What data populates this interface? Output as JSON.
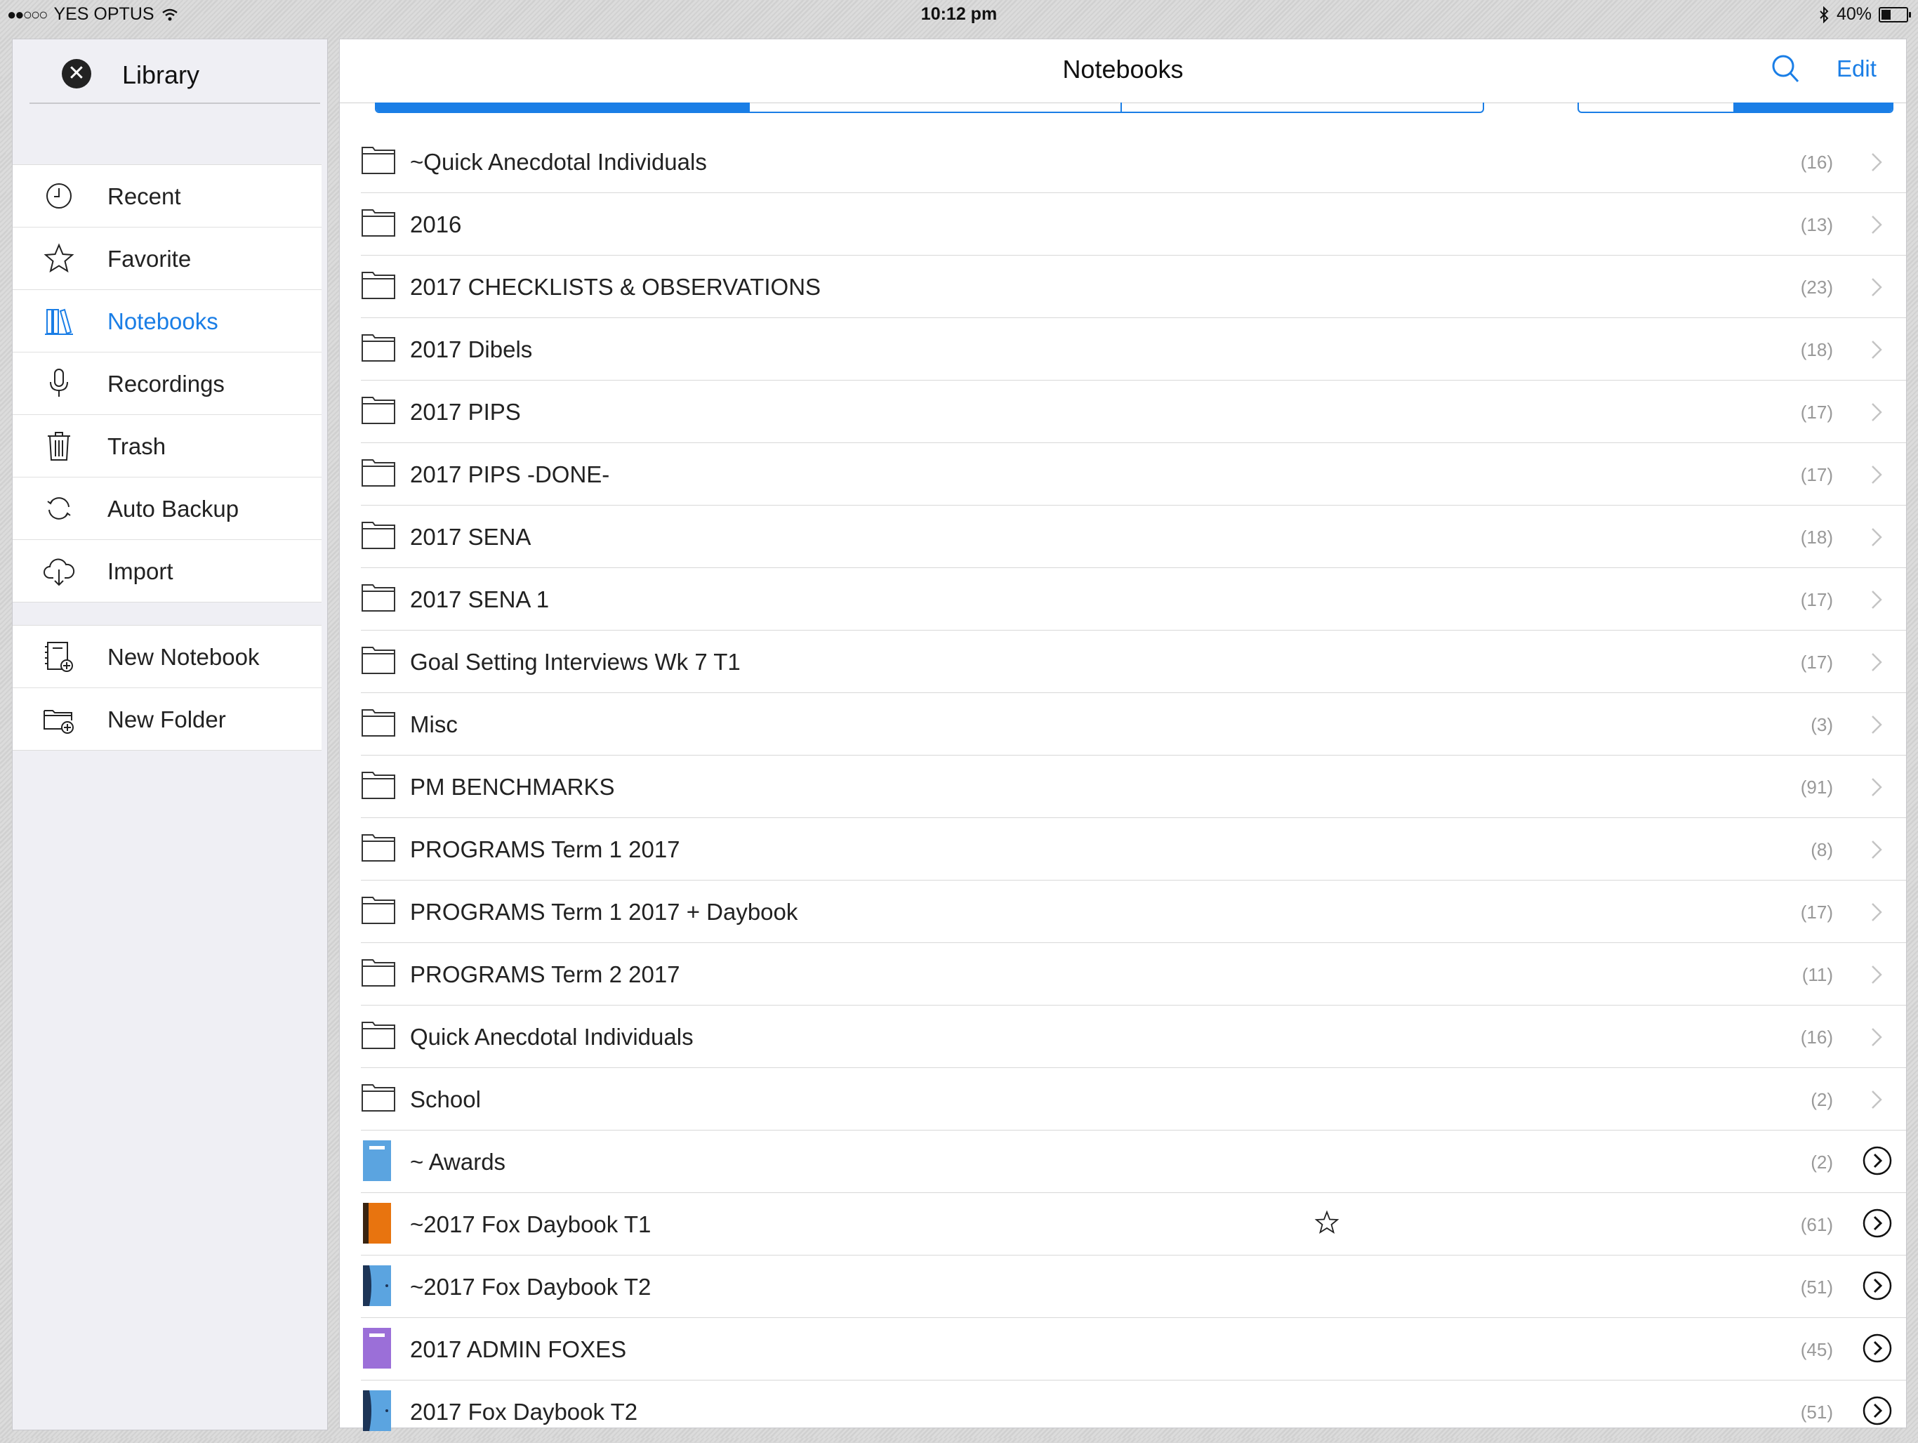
{
  "status": {
    "carrier": "YES OPTUS",
    "time": "10:12 pm",
    "battery": "40%",
    "battery_level": 0.4
  },
  "sidebar": {
    "title": "Library",
    "items": [
      {
        "label": "Recent",
        "icon": "clock-icon"
      },
      {
        "label": "Favorite",
        "icon": "star-icon"
      },
      {
        "label": "Notebooks",
        "icon": "books-icon",
        "active": true
      },
      {
        "label": "Recordings",
        "icon": "microphone-icon"
      },
      {
        "label": "Trash",
        "icon": "trash-icon"
      },
      {
        "label": "Auto Backup",
        "icon": "sync-icon"
      },
      {
        "label": "Import",
        "icon": "cloud-download-icon"
      }
    ],
    "actions": [
      {
        "label": "New Notebook",
        "icon": "new-notebook-icon"
      },
      {
        "label": "New Folder",
        "icon": "new-folder-icon"
      }
    ]
  },
  "navbar": {
    "title": "Notebooks",
    "edit_label": "Edit"
  },
  "colors": {
    "accent": "#1a7ee6",
    "count_text": "#999999"
  },
  "rows": [
    {
      "name": "~Quick Anecdotal Individuals",
      "count": "(16)",
      "type": "folder"
    },
    {
      "name": "2016",
      "count": "(13)",
      "type": "folder"
    },
    {
      "name": "2017 CHECKLISTS & OBSERVATIONS",
      "count": "(23)",
      "type": "folder"
    },
    {
      "name": "2017 Dibels",
      "count": "(18)",
      "type": "folder"
    },
    {
      "name": "2017 PIPS",
      "count": "(17)",
      "type": "folder"
    },
    {
      "name": "2017 PIPS -DONE-",
      "count": "(17)",
      "type": "folder"
    },
    {
      "name": "2017 SENA",
      "count": "(18)",
      "type": "folder"
    },
    {
      "name": "2017 SENA 1",
      "count": "(17)",
      "type": "folder"
    },
    {
      "name": "Goal Setting Interviews Wk 7 T1",
      "count": "(17)",
      "type": "folder"
    },
    {
      "name": "Misc",
      "count": "(3)",
      "type": "folder"
    },
    {
      "name": "PM BENCHMARKS",
      "count": "(91)",
      "type": "folder"
    },
    {
      "name": "PROGRAMS Term 1 2017",
      "count": "(8)",
      "type": "folder"
    },
    {
      "name": "PROGRAMS Term 1 2017 + Daybook",
      "count": "(17)",
      "type": "folder"
    },
    {
      "name": "PROGRAMS Term 2 2017",
      "count": "(11)",
      "type": "folder"
    },
    {
      "name": "Quick Anecdotal Individuals",
      "count": "(16)",
      "type": "folder"
    },
    {
      "name": "School",
      "count": "(2)",
      "type": "folder"
    },
    {
      "name": "~ Awards",
      "count": "(2)",
      "type": "notebook",
      "cover": "blue"
    },
    {
      "name": "~2017 Fox Daybook T1",
      "count": "(61)",
      "type": "notebook",
      "cover": "orange",
      "favorite": true
    },
    {
      "name": "~2017 Fox Daybook T2",
      "count": "(51)",
      "type": "notebook",
      "cover": "navy-blue"
    },
    {
      "name": "2017 ADMIN FOXES",
      "count": "(45)",
      "type": "notebook",
      "cover": "purple"
    },
    {
      "name": "2017 Fox Daybook T2",
      "count": "(51)",
      "type": "notebook",
      "cover": "navy-blue"
    }
  ]
}
